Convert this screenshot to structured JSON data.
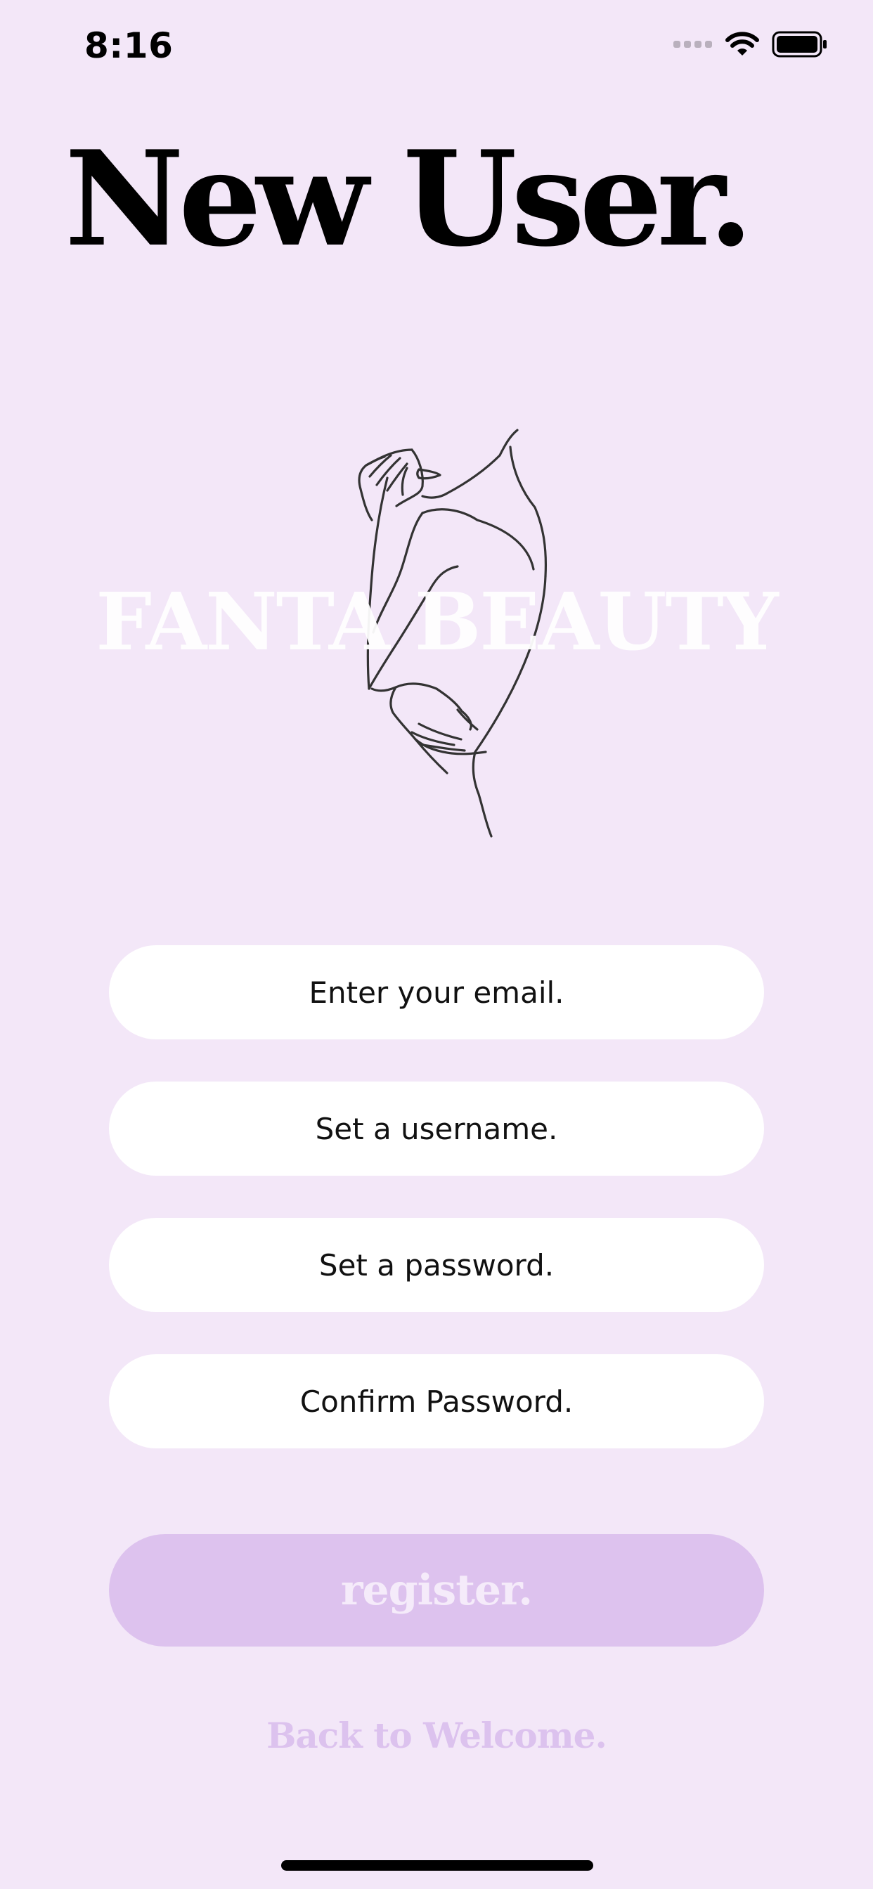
{
  "status_bar": {
    "time": "8:16"
  },
  "page": {
    "title": "New User.",
    "brand_text": "FANTA BEAUTY"
  },
  "form": {
    "email_placeholder": "Enter your email.",
    "username_placeholder": "Set a username.",
    "password_placeholder": "Set a password.",
    "confirm_placeholder": "Confirm Password.",
    "register_label": "register.",
    "back_label": "Back to Welcome."
  },
  "colors": {
    "background": "#f3e7f8",
    "field_background": "#ffffff",
    "register_background": "#ddc2ee",
    "register_text": "#f5ebfa",
    "back_link_text": "#dcc2ee",
    "title_text": "#000000"
  },
  "icons": {
    "signal": "cellular-signal-icon",
    "wifi": "wifi-icon",
    "battery": "battery-icon",
    "illustration": "line-art-figure-icon"
  }
}
